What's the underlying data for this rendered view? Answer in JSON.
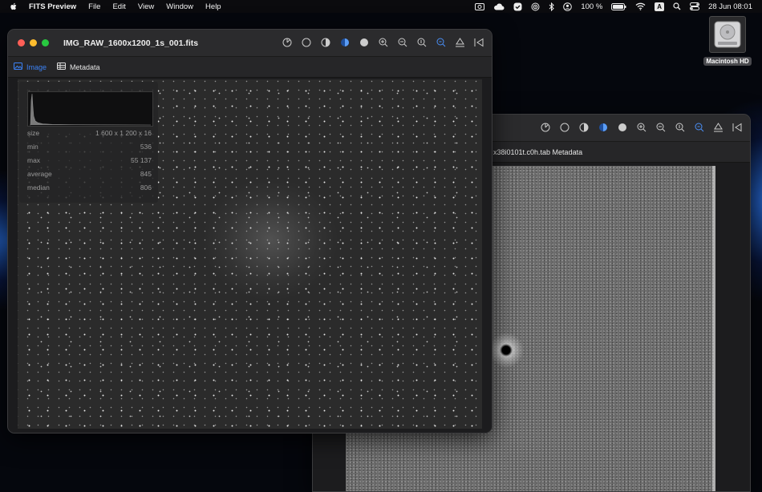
{
  "menubar": {
    "app_name": "FITS Preview",
    "menus": [
      "File",
      "Edit",
      "View",
      "Window",
      "Help"
    ],
    "battery": "100 %",
    "input_source": "A",
    "datetime": "28 Jun  08:01"
  },
  "desktop": {
    "disk_label": "Macintosh HD"
  },
  "front_window": {
    "title": "IMG_RAW_1600x1200_1s_001.fits",
    "tabs": [
      {
        "label": "Image",
        "active": true
      },
      {
        "label": "Metadata",
        "active": false
      }
    ],
    "stats": [
      {
        "label": "size",
        "value": "1 600 x 1 200 x 16"
      },
      {
        "label": "min",
        "value": "536"
      },
      {
        "label": "max",
        "value": "55 137"
      },
      {
        "label": "average",
        "value": "845"
      },
      {
        "label": "median",
        "value": "806"
      }
    ]
  },
  "back_window": {
    "tab_label": "x38i0101t.c0h.tab Metadata"
  },
  "colors": {
    "accent": "#3b82f6",
    "window_bg": "#242426",
    "titlebar": "#2b2b2d"
  },
  "toolbar_icons": [
    "auto-stretch-icon",
    "circle-outline-icon",
    "half-circle-icon",
    "half-circle-blue-icon",
    "filled-circle-icon",
    "zoom-in-icon",
    "zoom-out-icon",
    "zoom-actual-icon",
    "zoom-fit-icon",
    "flip-vertical-icon",
    "flip-horizontal-icon"
  ]
}
